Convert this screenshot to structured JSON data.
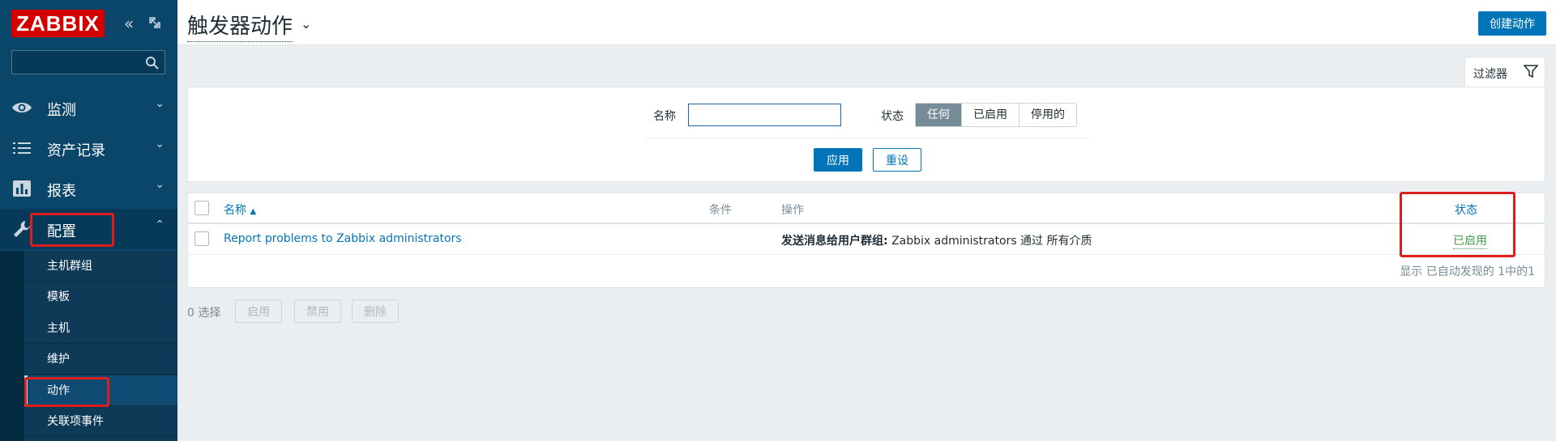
{
  "sidebar": {
    "logo_text": "ZABBIX",
    "collapse_icon": "double-chevron-left-icon",
    "kiosk_icon": "expand-icon",
    "search_placeholder": "",
    "menu": [
      {
        "label": "监测",
        "icon": "eye-icon"
      },
      {
        "label": "资产记录",
        "icon": "list-icon"
      },
      {
        "label": "报表",
        "icon": "bar-chart-icon"
      },
      {
        "label": "配置",
        "icon": "wrench-icon"
      }
    ],
    "submenu": [
      {
        "label": "主机群组"
      },
      {
        "label": "模板"
      },
      {
        "label": "主机"
      },
      {
        "label": "维护"
      },
      {
        "label": "动作"
      },
      {
        "label": "关联项事件"
      }
    ]
  },
  "header": {
    "title": "触发器动作",
    "create_button": "创建动作"
  },
  "filter": {
    "tab_label": "过滤器",
    "name_label": "名称",
    "name_value": "",
    "status_label": "状态",
    "status_options": [
      "任何",
      "已启用",
      "停用的"
    ],
    "status_selected": "任何",
    "apply": "应用",
    "reset": "重设"
  },
  "table": {
    "columns": {
      "name": "名称",
      "conditions": "条件",
      "operations": "操作",
      "status": "状态"
    },
    "rows": [
      {
        "name": "Report problems to Zabbix administrators",
        "conditions": "",
        "operation_prefix": "发送消息给用户群组:",
        "operation_text": "Zabbix administrators 通过 所有介质",
        "status": "已启用"
      }
    ],
    "footer": "显示 已自动发现的 1中的1"
  },
  "actions": {
    "selected_count": "0 选择",
    "enable": "启用",
    "disable": "禁用",
    "delete": "删除"
  },
  "colors": {
    "sidebar_bg": "#0a466a",
    "accent": "#0275b8",
    "logo_red": "#d40000",
    "status_green": "#429e47",
    "highlight_red": "#e01d1d"
  }
}
